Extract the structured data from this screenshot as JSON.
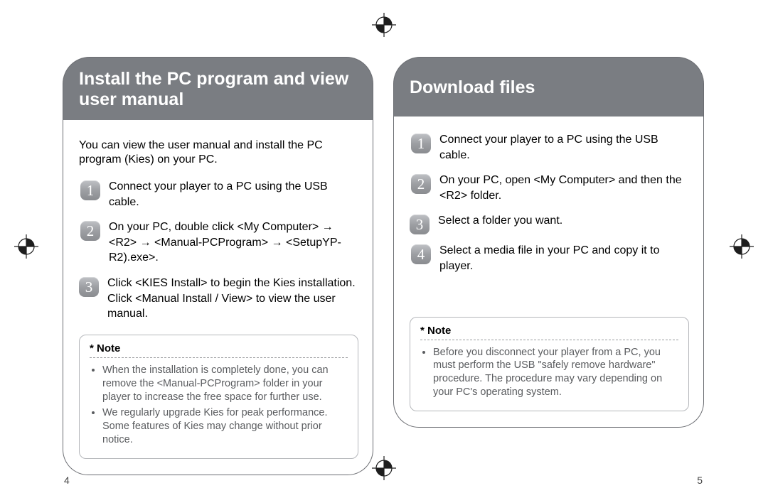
{
  "regmark_color": "#3a3a3a",
  "left": {
    "header": "Install the PC program and view user manual",
    "intro": "You can view the user manual and install the PC program (Kies) on your PC.",
    "steps": [
      "Connect your player to a PC using the USB cable.",
      "On your PC, double click <My Computer> → <R2> → <Manual-PCProgram> → <SetupYP-R2).exe>.",
      "Click <KIES Install> to begin the Kies installation.\nClick <Manual Install / View> to view the user manual."
    ],
    "note_title": "* Note",
    "notes": [
      "When the installation is completely done, you can remove the <Manual-PCProgram> folder in your player to increase the free space for further use.",
      "We regularly upgrade Kies for peak performance. Some features of Kies may change without prior notice."
    ],
    "pagenum": "4"
  },
  "right": {
    "header": "Download files",
    "steps": [
      "Connect your player to a PC using the USB cable.",
      "On your PC, open <My Computer> and then the <R2> folder.",
      "Select a folder you want.",
      "Select a media file in your PC and copy it to player."
    ],
    "note_title": "* Note",
    "notes": [
      "Before you disconnect your player from a PC, you must perform the USB \"safely remove hardware\" procedure. The procedure may vary depending on your PC's operating system."
    ],
    "pagenum": "5"
  }
}
